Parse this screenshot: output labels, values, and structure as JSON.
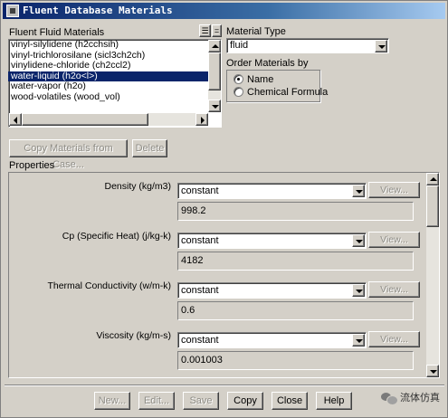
{
  "window": {
    "title": "Fluent Database Materials"
  },
  "fluids": {
    "label": "Fluent Fluid Materials",
    "items": [
      "vinyl-silylidene (h2cchsih)",
      "vinyl-trichlorosilane (sicl3ch2ch)",
      "vinylidene-chloride (ch2ccl2)",
      "water-liquid (h2o<l>)",
      "water-vapor (h2o)",
      "wood-volatiles (wood_vol)"
    ],
    "selected": "water-liquid (h2o<l>)"
  },
  "material_type": {
    "label": "Material Type",
    "value": "fluid"
  },
  "order": {
    "label": "Order Materials by",
    "options": [
      "Name",
      "Chemical Formula"
    ],
    "selected": "Name"
  },
  "actions": {
    "copy_case": "Copy Materials from Case...",
    "delete": "Delete"
  },
  "properties": {
    "label": "Properties",
    "items": [
      {
        "name": "Density (kg/m3)",
        "method": "constant",
        "view": "View...",
        "value": "998.2"
      },
      {
        "name": "Cp (Specific Heat) (j/kg-k)",
        "method": "constant",
        "view": "View...",
        "value": "4182"
      },
      {
        "name": "Thermal Conductivity (w/m-k)",
        "method": "constant",
        "view": "View...",
        "value": "0.6"
      },
      {
        "name": "Viscosity (kg/m-s)",
        "method": "constant",
        "view": "View...",
        "value": "0.001003"
      }
    ]
  },
  "footer": {
    "new": "New...",
    "edit": "Edit...",
    "save": "Save",
    "copy": "Copy",
    "close": "Close",
    "help": "Help"
  },
  "watermark": {
    "text": "流体仿真",
    "icon": "wechat-icon"
  }
}
